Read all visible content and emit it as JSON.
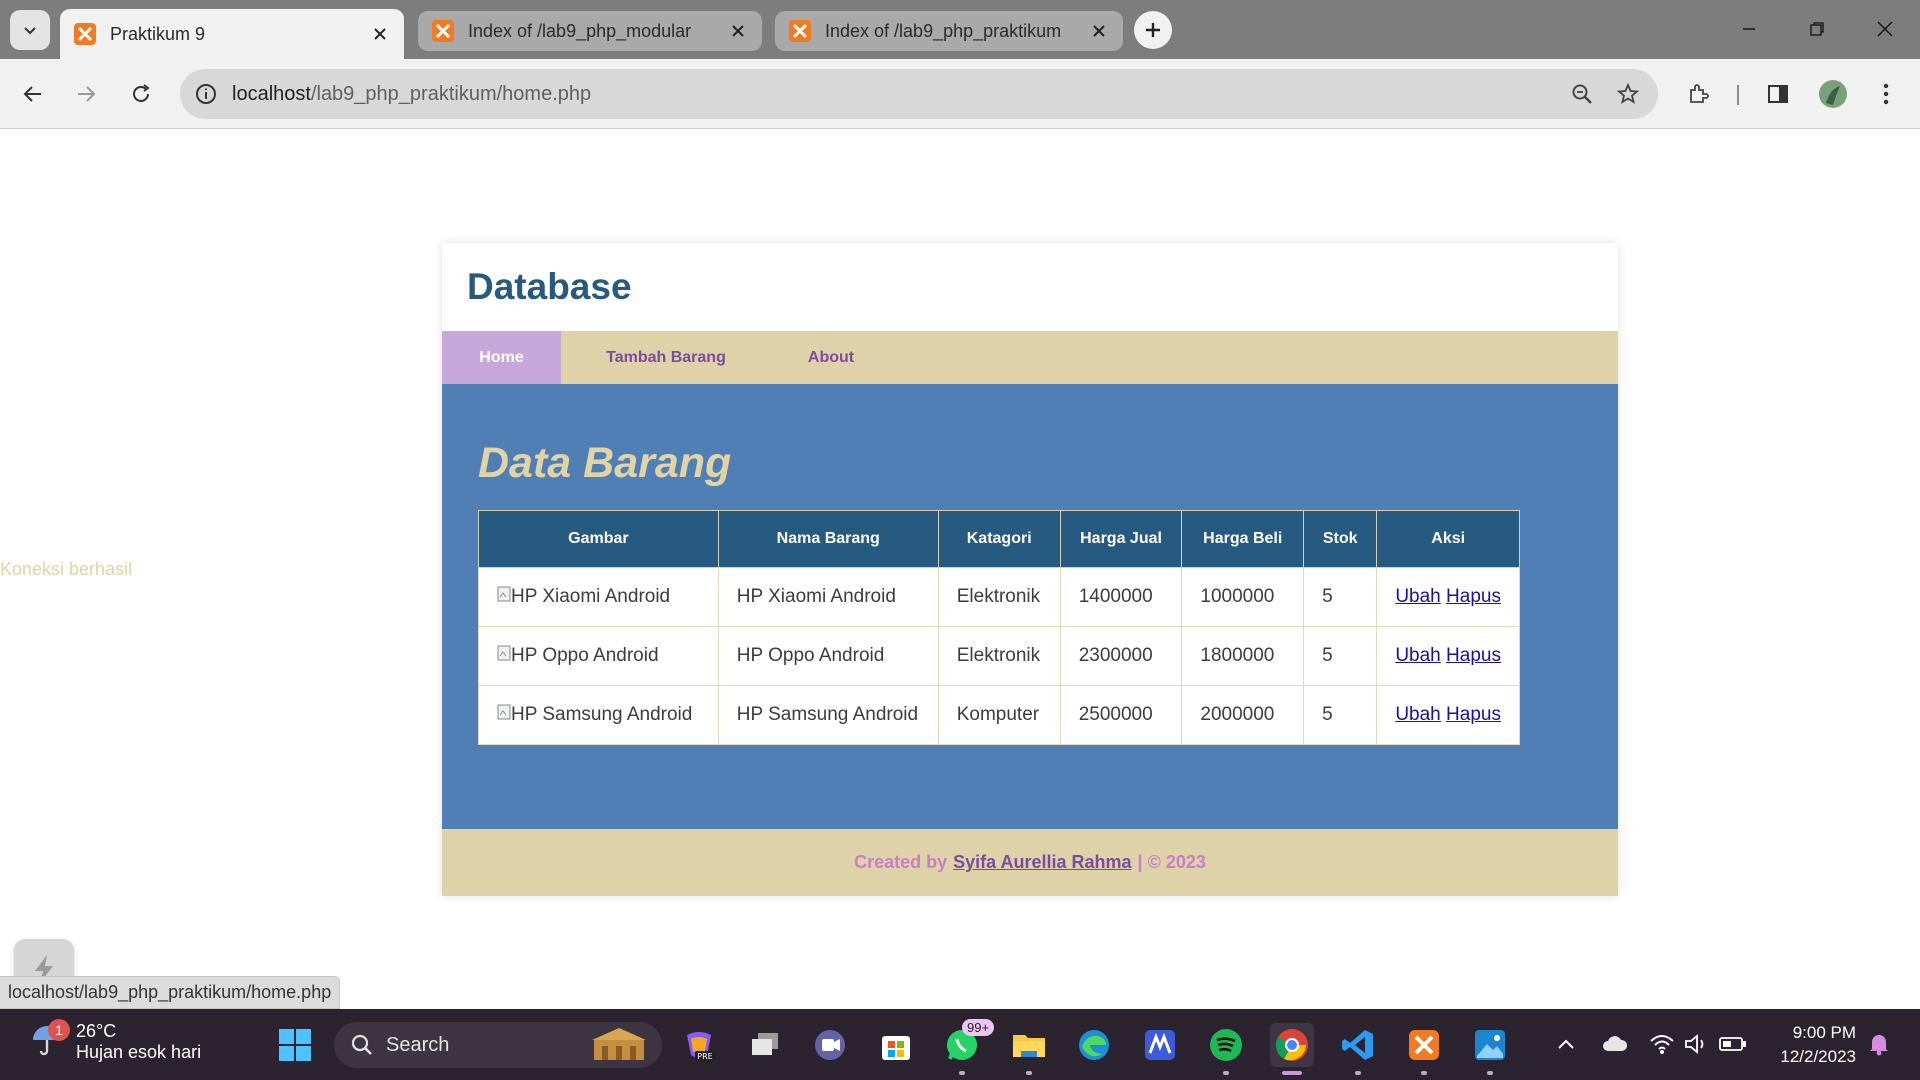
{
  "browser": {
    "tabs": [
      {
        "title": "Praktikum 9",
        "active": true
      },
      {
        "title": "Index of /lab9_php_modular",
        "active": false
      },
      {
        "title": "Index of /lab9_php_praktikum",
        "active": false
      }
    ],
    "url_host": "localhost",
    "url_path": "/lab9_php_praktikum/home.php",
    "status_url": "localhost/lab9_php_praktikum/home.php"
  },
  "page": {
    "koneksi": "Koneksi berhasil",
    "header_title": "Database",
    "nav": {
      "home": "Home",
      "tambah": "Tambah Barang",
      "about": "About"
    },
    "section_title": "Data Barang",
    "table": {
      "headers": [
        "Gambar",
        "Nama Barang",
        "Katagori",
        "Harga Jual",
        "Harga Beli",
        "Stok",
        "Aksi"
      ],
      "rows": [
        {
          "gambar": "HP Xiaomi Android",
          "nama": "HP Xiaomi Android",
          "kategori": "Elektronik",
          "harga_jual": "1400000",
          "harga_beli": "1000000",
          "stok": "5",
          "ubah": "Ubah",
          "hapus": "Hapus"
        },
        {
          "gambar": "HP Oppo Android",
          "nama": "HP Oppo Android",
          "kategori": "Elektronik",
          "harga_jual": "2300000",
          "harga_beli": "1800000",
          "stok": "5",
          "ubah": "Ubah",
          "hapus": "Hapus"
        },
        {
          "gambar": "HP Samsung Android",
          "nama": "HP Samsung Android",
          "kategori": "Komputer",
          "harga_jual": "2500000",
          "harga_beli": "2000000",
          "stok": "5",
          "ubah": "Ubah",
          "hapus": "Hapus"
        }
      ]
    },
    "footer": {
      "prefix": "Created by",
      "author": "Syifa Aurellia Rahma",
      "suffix": "| © 2023"
    }
  },
  "taskbar": {
    "weather_temp": "26°C",
    "weather_cond": "Hujan esok hari",
    "weather_badge": "1",
    "search_placeholder": "Search",
    "whatsapp_badge": "99+",
    "time": "9:00 PM",
    "date": "12/2/2023"
  },
  "colors": {
    "header_blue": "#265a80",
    "main_blue": "#4f7fb4",
    "nav_beige": "#dfd2a9",
    "nav_active": "#c8a8da",
    "accent_purple": "#7b4c9e"
  }
}
